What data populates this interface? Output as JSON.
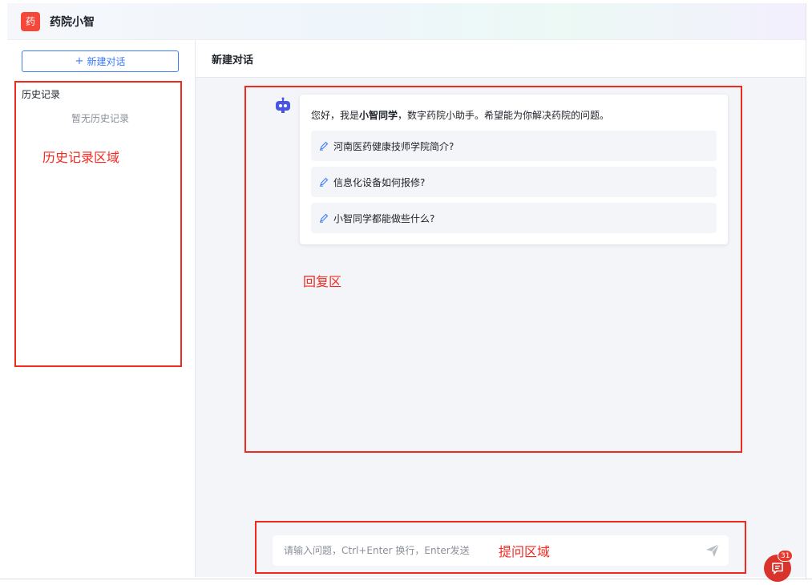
{
  "header": {
    "logo_text": "药",
    "app_title": "药院小智"
  },
  "sidebar": {
    "new_chat_label": "新建对话",
    "new_chat_icon": "plus-icon",
    "history_title": "历史记录",
    "history_empty": "暂无历史记录"
  },
  "main": {
    "title": "新建对话",
    "bot_icon": "robot-icon",
    "greeting": {
      "prefix": "您好，我是",
      "name": "小智同学",
      "suffix": "，数字药院小助手。希望能为你解决药院的问题。"
    },
    "suggestion_icon": "pen-icon",
    "suggestions": [
      {
        "label": "河南医药健康技师学院简介?"
      },
      {
        "label": "信息化设备如何报修?"
      },
      {
        "label": "小智同学都能做些什么?"
      }
    ]
  },
  "input": {
    "placeholder": "请输入问题，Ctrl+Enter 换行，Enter发送",
    "send_icon": "send-icon"
  },
  "annotations": {
    "history_area": "历史记录区域",
    "reply_area": "回复区",
    "question_area": "提问区域"
  },
  "floating": {
    "badge_count": "31",
    "icon": "message-icon"
  },
  "colors": {
    "accent": "#3b7cf5",
    "brand": "#f5483b",
    "annotation": "#f2291f",
    "background": "#f4f5f8"
  }
}
